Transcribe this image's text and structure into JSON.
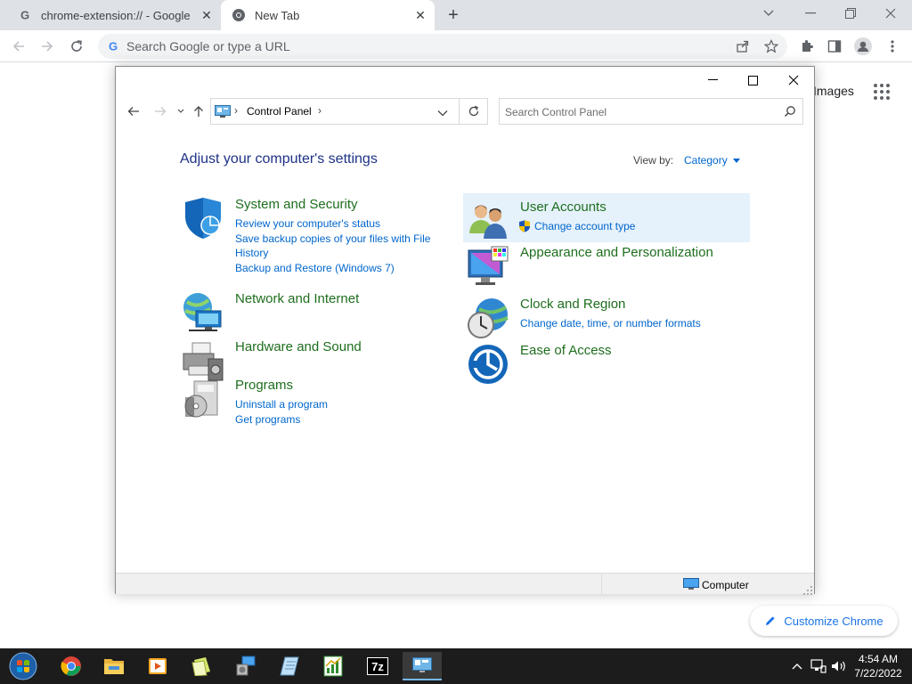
{
  "browser": {
    "tabs": [
      {
        "title": "chrome-extension:// - Google Se",
        "active": false
      },
      {
        "title": "New Tab",
        "active": true
      }
    ],
    "omnibox_placeholder": "Search Google or type a URL"
  },
  "ntp": {
    "images_label": "Images",
    "customize_label": "Customize Chrome"
  },
  "control_panel": {
    "breadcrumb": "Control Panel",
    "search_placeholder": "Search Control Panel",
    "heading": "Adjust your computer's settings",
    "view_by_label": "View by:",
    "view_by_value": "Category",
    "categories": [
      {
        "title": "System and Security",
        "links": [
          "Review your computer's status",
          "Save backup copies of your files with File History",
          "Backup and Restore (Windows 7)"
        ]
      },
      {
        "title": "Network and Internet",
        "links": []
      },
      {
        "title": "Hardware and Sound",
        "links": []
      },
      {
        "title": "Programs",
        "links": [
          "Uninstall a program",
          "Get programs"
        ]
      },
      {
        "title": "User Accounts",
        "links": [
          "Change account type"
        ]
      },
      {
        "title": "Appearance and Personalization",
        "links": []
      },
      {
        "title": "Clock and Region",
        "links": [
          "Change date, time, or number formats"
        ]
      },
      {
        "title": "Ease of Access",
        "links": []
      }
    ],
    "status_location": "Computer"
  },
  "taskbar": {
    "time": "4:54 AM",
    "date": "7/22/2022",
    "seven_zip_label": "7z"
  },
  "colors": {
    "heading_blue": "#1e3287",
    "category_green": "#1e6e1e",
    "link_blue": "#0066cc",
    "chrome_blue": "#1a73e8"
  }
}
